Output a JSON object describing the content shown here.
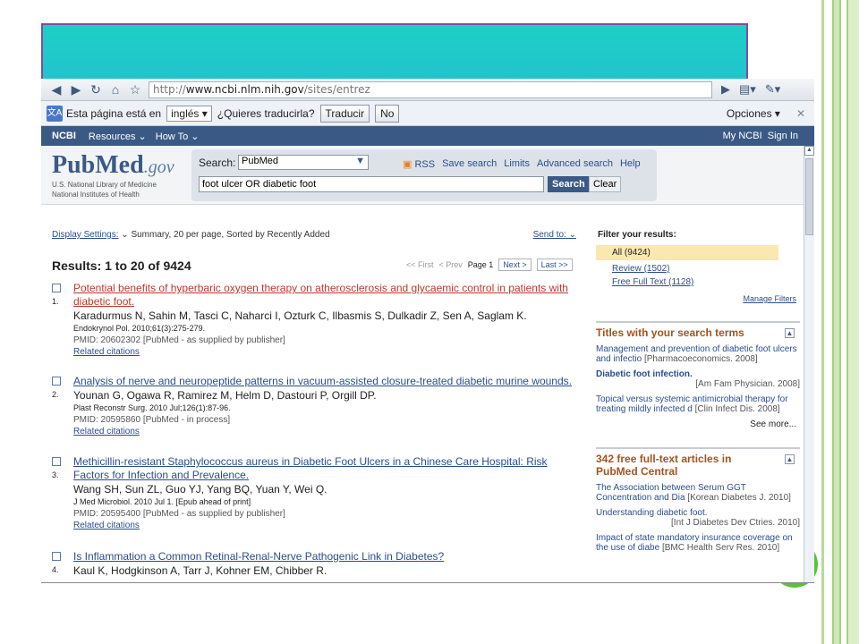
{
  "browser": {
    "url_prefix": "http://",
    "url_host": "www.ncbi.nlm.nih.gov",
    "url_path": "/sites/entrez"
  },
  "translate": {
    "page_in": "Esta página está en",
    "language": "inglés",
    "question": "¿Quieres traducirla?",
    "translate_btn": "Traducir",
    "no_btn": "No",
    "options": "Opciones"
  },
  "ncbi": {
    "logo": "NCBI",
    "resources": "Resources",
    "howto": "How To",
    "myncbi": "My NCBI",
    "signin": "Sign In"
  },
  "pubmed": {
    "logo_main": "PubMed",
    "logo_gov": ".gov",
    "sub1": "U.S. National Library of Medicine",
    "sub2": "National Institutes of Health",
    "search_label": "Search:",
    "db": "PubMed",
    "rss": "RSS",
    "save_search": "Save search",
    "limits": "Limits",
    "advanced": "Advanced search",
    "help": "Help",
    "query": "foot ulcer OR diabetic foot",
    "search_btn": "Search",
    "clear_btn": "Clear"
  },
  "display": {
    "settings": "Display Settings:",
    "desc": "Summary, 20 per page, Sorted by Recently Added",
    "send_to": "Send to:"
  },
  "results": {
    "count": "Results: 1 to 20 of 9424",
    "first": "<< First",
    "prev": "< Prev",
    "page": "Page 1",
    "next": "Next >",
    "last": "Last >>",
    "items": [
      {
        "num": "1.",
        "title": "Potential benefits of hyperbaric oxygen therapy on atherosclerosis and glycaemic control in patients with diabetic foot.",
        "authors": "Karadurmus N, Sahin M, Tasci C, Naharci I, Ozturk C, Ilbasmis S, Dulkadir Z, Sen A, Saglam K.",
        "src": "Endokrynol Pol. 2010;61(3):275-279.",
        "pmid": "PMID: 20602302 [PubMed - as supplied by publisher]",
        "rel": "Related citations"
      },
      {
        "num": "2.",
        "title": "Analysis of nerve and neuropeptide patterns in vacuum-assisted closure-treated diabetic murine wounds.",
        "authors": "Younan G, Ogawa R, Ramirez M, Helm D, Dastouri P, Orgill DP.",
        "src": "Plast Reconstr Surg. 2010 Jul;126(1):87-96.",
        "pmid": "PMID: 20595860 [PubMed - in process]",
        "rel": "Related citations"
      },
      {
        "num": "3.",
        "title": "Methicillin-resistant Staphylococcus aureus in Diabetic Foot Ulcers in a Chinese Care Hospital: Risk Factors for Infection and Prevalence.",
        "authors": "Wang SH, Sun ZL, Guo YJ, Yang BQ, Yuan Y, Wei Q.",
        "src": "J Med Microbiol. 2010 Jul 1. [Epub ahead of print]",
        "pmid": "PMID: 20595400 [PubMed - as supplied by publisher]",
        "rel": "Related citations"
      },
      {
        "num": "4.",
        "title": "Is Inflammation a Common Retinal-Renal-Nerve Pathogenic Link in Diabetes?",
        "authors": "Kaul K, Hodgkinson A, Tarr J, Kohner EM, Chibber R.",
        "src": "",
        "pmid": "",
        "rel": ""
      }
    ]
  },
  "sidebar": {
    "filter_head": "Filter your results:",
    "all": "All (9424)",
    "review": "Review (1502)",
    "free": "Free Full Text (1128)",
    "manage": "Manage Filters",
    "titles_head": "Titles with your search terms",
    "titles": [
      {
        "title": "Management and prevention of diabetic foot ulcers and infectio",
        "cite": "[Pharmacoeconomics. 2008]"
      },
      {
        "title": "Diabetic foot infection.",
        "cite": "[Am Fam Physician. 2008]"
      },
      {
        "title": "Topical versus systemic antimicrobial therapy for treating mildly infected d",
        "cite": "[Clin Infect Dis. 2008]"
      }
    ],
    "see_more": "See more...",
    "pmc_head": "342 free full-text articles in PubMed Central",
    "pmc": [
      {
        "title": "The Association between Serum GGT Concentration and Dia",
        "cite": "[Korean Diabetes J. 2010]"
      },
      {
        "title": "Understanding diabetic foot.",
        "cite": "[Int J Diabetes Dev Ctries. 2010]"
      },
      {
        "title": "Impact of state mandatory insurance coverage on the use of diabe",
        "cite": "[BMC Health Serv Res. 2010]"
      }
    ]
  }
}
